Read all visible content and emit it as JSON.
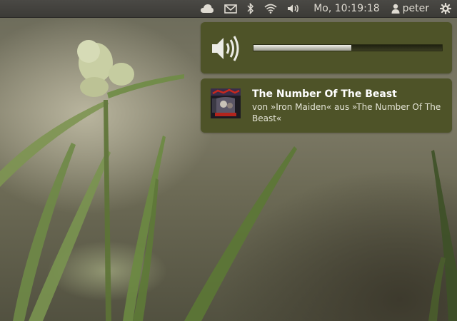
{
  "panel": {
    "indicators": [
      "cloud-icon",
      "mail-icon",
      "bluetooth-icon",
      "wifi-icon",
      "volume-icon"
    ],
    "clock": "Mo, 10:19:18",
    "user": "peter",
    "session_icon": "gear-icon"
  },
  "volume_osd": {
    "icon": "speaker-icon",
    "level": 0.52
  },
  "now_playing": {
    "title": "The Number Of The Beast",
    "description": "von »Iron Maiden« aus »The Number Of The Beast«"
  },
  "colors": {
    "panel": "#3c3b37",
    "bubble": "#4e5328",
    "text": "#ffffff"
  }
}
